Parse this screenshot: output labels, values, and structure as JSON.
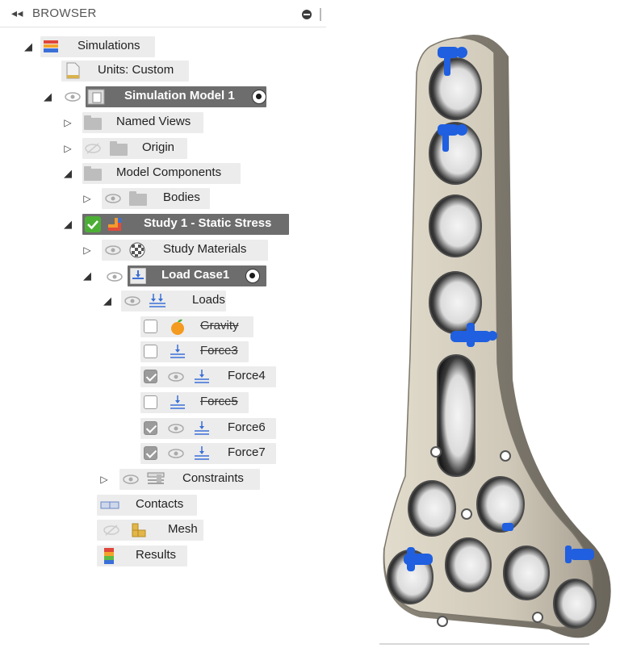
{
  "browser": {
    "title": "BROWSER",
    "collapse_glyph": "◂◂"
  },
  "tree": {
    "simulations": "Simulations",
    "units": "Units: Custom",
    "simulation_model": "Simulation Model 1",
    "named_views": "Named Views",
    "origin": "Origin",
    "model_components": "Model Components",
    "bodies": "Bodies",
    "study": "Study 1 - Static Stress",
    "study_materials": "Study Materials",
    "load_case": "Load Case1",
    "loads": "Loads",
    "gravity": "Gravity",
    "force3": "Force3",
    "force4": "Force4",
    "force5": "Force5",
    "force6": "Force6",
    "force7": "Force7",
    "constraints": "Constraints",
    "contacts": "Contacts",
    "mesh": "Mesh",
    "results": "Results"
  },
  "checkboxes": {
    "gravity": false,
    "force3": false,
    "force4": true,
    "force5": false,
    "force6": true,
    "force7": true
  },
  "colors": {
    "dark_pill": "#6d6d6d",
    "light_pill": "#ececec",
    "study_check": "#4caf35",
    "load_arrow_blue": "#1f5fe0",
    "plate_metal": "#cfc8b8"
  }
}
